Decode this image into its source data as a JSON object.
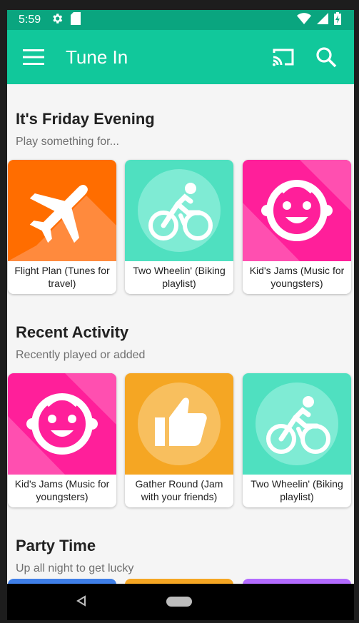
{
  "status": {
    "time": "5:59"
  },
  "appbar": {
    "title": "Tune In"
  },
  "sections": [
    {
      "title": "It's Friday Evening",
      "subtitle": "Play something for...",
      "cards": [
        {
          "caption": "Flight Plan (Tunes for travel)",
          "icon": "airplane-icon",
          "color": "#ff6d00"
        },
        {
          "caption": "Two Wheelin' (Biking playlist)",
          "icon": "bike-icon",
          "color": "#4fe0c0"
        },
        {
          "caption": "Kid's Jams (Music for youngsters)",
          "icon": "baby-face-icon",
          "color": "#ff1f9a"
        }
      ]
    },
    {
      "title": "Recent Activity",
      "subtitle": "Recently played or added",
      "cards": [
        {
          "caption": "Kid's Jams (Music for youngsters)",
          "icon": "baby-face-icon",
          "color": "#ff1f9a"
        },
        {
          "caption": "Gather Round (Jam with your friends)",
          "icon": "thumbs-up-icon",
          "color": "#f5a623"
        },
        {
          "caption": "Two Wheelin' (Biking playlist)",
          "icon": "bike-icon",
          "color": "#4fe0c0"
        }
      ]
    },
    {
      "title": "Party Time",
      "subtitle": "Up all night to get lucky",
      "cards": [
        {
          "color": "#3f7fe8"
        },
        {
          "color": "#f5a623"
        },
        {
          "color": "#b36bff"
        }
      ]
    }
  ]
}
